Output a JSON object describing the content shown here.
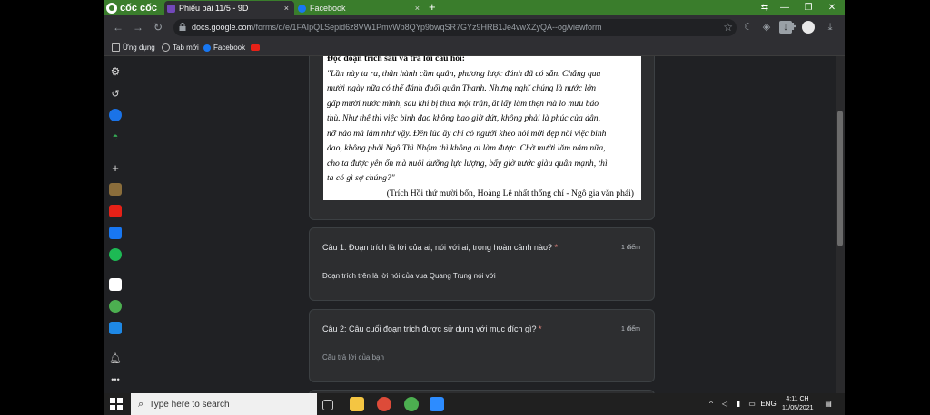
{
  "browser": {
    "brand": "cốc cốc",
    "tabs": [
      {
        "label": "Phiếu bài 11/5 - 9D",
        "close": "×"
      },
      {
        "label": "Facebook",
        "close": "×"
      }
    ],
    "new_tab": "+",
    "url_host": "docs.google.com",
    "url_path": "/forms/d/e/1FAIpQLSepid6z8VW1PmvWb8QYp9bwqSR7GYz9HRB1Je4vwXZyQA--og/viewform",
    "bookmarks": [
      {
        "label": "Ứng dụng"
      },
      {
        "label": "Tab mới"
      },
      {
        "label": "Facebook"
      }
    ]
  },
  "form": {
    "passage": {
      "heading": "Đọc đoạn trích sau và trả lời câu hỏi:",
      "lines": [
        "\"Lần này ta ra, thân hành cầm quân, phương lược đánh đã có sẵn. Chẳng qua",
        "mười ngày nữa có thể đánh đuổi quân Thanh. Nhưng nghĩ chúng là nước lớn",
        "gấp mười nước mình, sau khi bị thua một trận, ắt lấy làm thẹn mà lo mưu báo",
        "thù. Như thế thì việc binh đao không bao giờ dứt, không phải là phúc của dân,",
        "nỡ nào mà làm như vậy. Đến lúc ấy chỉ có người khéo nói mới dẹp nổi việc binh",
        "đao, không phải Ngô Thì Nhậm thì không ai làm được. Chờ mười lăm năm nữa,",
        "cho ta được yên ổn mà nuôi dưỡng lực lượng, bấy giờ nước giàu quân mạnh, thì",
        "ta có gì sợ chúng?\""
      ],
      "source": "(Trích Hồi thứ mười bốn, Hoàng Lê nhất thống chí - Ngô gia văn phái)"
    },
    "questions": [
      {
        "title": "Câu 1: Đoạn trích là lời của ai, nói với ai, trong hoàn cảnh nào?",
        "required": "*",
        "points": "1 điểm",
        "answer": "Đoạn trích trên là lời nói của vua Quang Trung nói với"
      },
      {
        "title": "Câu 2: Câu cuối đoạn trích được sử dụng với mục đích gì?",
        "required": "*",
        "points": "1 điểm",
        "placeholder": "Câu trả lời của bạn"
      }
    ]
  },
  "taskbar": {
    "search_placeholder": "Type here to search",
    "language": "ENG",
    "time": "4:11 CH",
    "date": "11/05/2021"
  },
  "colors": {
    "brand_green": "#3a7d2c",
    "accent_purple": "#8e6fdd",
    "required_red": "#f28b82"
  }
}
